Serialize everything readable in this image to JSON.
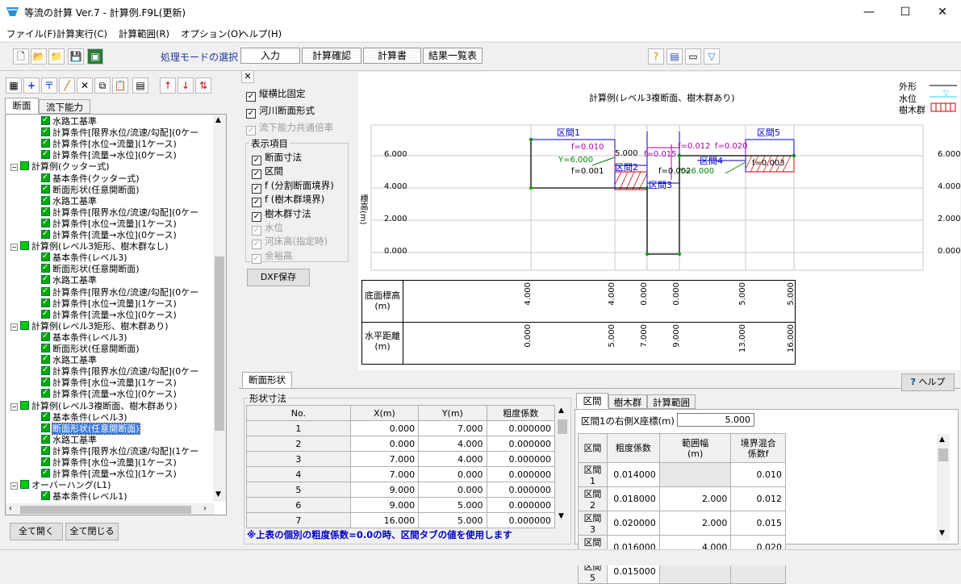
{
  "window": {
    "title": "等流の計算 Ver.7 - 計算例.F9L(更新)",
    "min": "—",
    "max": "☐",
    "close": "✕"
  },
  "menu": [
    "ファイル(F)",
    "計算実行(C)",
    "計算範囲(R)",
    "オプション(O)",
    "ヘルプ(H)"
  ],
  "mode": {
    "label": "処理モードの選択",
    "buttons": [
      "入力",
      "計算確認",
      "計算書",
      "結果一覧表"
    ]
  },
  "left": {
    "tabs": [
      "断面",
      "流下能力"
    ],
    "tree": [
      {
        "indent": 2,
        "expander": "",
        "text": "水路工基準"
      },
      {
        "indent": 2,
        "expander": "",
        "text": "計算条件[限界水位/流速/勾配](0ケー"
      },
      {
        "indent": 2,
        "expander": "",
        "text": "計算条件[水位→流量](1ケース)"
      },
      {
        "indent": 2,
        "expander": "",
        "text": "計算条件[流量→水位](0ケース)"
      },
      {
        "indent": 1,
        "expander": "−",
        "text": "計算例(クッター式)"
      },
      {
        "indent": 2,
        "expander": "",
        "text": "基本条件(クッター式)"
      },
      {
        "indent": 2,
        "expander": "",
        "text": "断面形状(任意開断面)"
      },
      {
        "indent": 2,
        "expander": "",
        "text": "水路工基準"
      },
      {
        "indent": 2,
        "expander": "",
        "text": "計算条件[限界水位/流速/勾配](0ケー"
      },
      {
        "indent": 2,
        "expander": "",
        "text": "計算条件[水位→流量](1ケース)"
      },
      {
        "indent": 2,
        "expander": "",
        "text": "計算条件[流量→水位](0ケース)"
      },
      {
        "indent": 1,
        "expander": "−",
        "text": "計算例(レベル3矩形、樹木群なし)"
      },
      {
        "indent": 2,
        "expander": "",
        "text": "基本条件(レベル3)"
      },
      {
        "indent": 2,
        "expander": "",
        "text": "断面形状(任意開断面)"
      },
      {
        "indent": 2,
        "expander": "",
        "text": "水路工基準"
      },
      {
        "indent": 2,
        "expander": "",
        "text": "計算条件[限界水位/流速/勾配](0ケー"
      },
      {
        "indent": 2,
        "expander": "",
        "text": "計算条件[水位→流量](1ケース)"
      },
      {
        "indent": 2,
        "expander": "",
        "text": "計算条件[流量→水位](0ケース)"
      },
      {
        "indent": 1,
        "expander": "−",
        "text": "計算例(レベル3矩形、樹木群あり)"
      },
      {
        "indent": 2,
        "expander": "",
        "text": "基本条件(レベル3)"
      },
      {
        "indent": 2,
        "expander": "",
        "text": "断面形状(任意開断面)"
      },
      {
        "indent": 2,
        "expander": "",
        "text": "水路工基準"
      },
      {
        "indent": 2,
        "expander": "",
        "text": "計算条件[限界水位/流速/勾配](0ケー"
      },
      {
        "indent": 2,
        "expander": "",
        "text": "計算条件[水位→流量](1ケース)"
      },
      {
        "indent": 2,
        "expander": "",
        "text": "計算条件[流量→水位](0ケース)"
      },
      {
        "indent": 1,
        "expander": "−",
        "text": "計算例(レベル3複断面、樹木群あり)"
      },
      {
        "indent": 2,
        "expander": "",
        "text": "基本条件(レベル3)"
      },
      {
        "indent": 2,
        "expander": "",
        "text": "断面形状(任意開断面)",
        "selected": true
      },
      {
        "indent": 2,
        "expander": "",
        "text": "水路工基準"
      },
      {
        "indent": 2,
        "expander": "",
        "text": "計算条件[限界水位/流速/勾配](1ケー"
      },
      {
        "indent": 2,
        "expander": "",
        "text": "計算条件[水位→流量](1ケース)"
      },
      {
        "indent": 2,
        "expander": "",
        "text": "計算条件[流量→水位](1ケース)"
      },
      {
        "indent": 1,
        "expander": "−",
        "text": "オーバーハング(L1)"
      },
      {
        "indent": 2,
        "expander": "",
        "text": "基本条件(レベル1)"
      }
    ],
    "expand_all": "全て開く",
    "collapse_all": "全て閉じる"
  },
  "options": {
    "close": "✕",
    "aspect": "縦横比固定",
    "river": "河川断面形式",
    "common": "流下能力共通倍率",
    "group": "表示項目",
    "items": [
      {
        "label": "断面寸法",
        "on": true,
        "enabled": true
      },
      {
        "label": "区間",
        "on": true,
        "enabled": true
      },
      {
        "label": "f (分割断面境界)",
        "on": true,
        "enabled": true
      },
      {
        "label": "f (樹木群境界)",
        "on": true,
        "enabled": true
      },
      {
        "label": "樹木群寸法",
        "on": true,
        "enabled": true
      },
      {
        "label": "水位",
        "on": true,
        "enabled": false
      },
      {
        "label": "河床高(指定時)",
        "on": true,
        "enabled": false
      },
      {
        "label": "余裕高",
        "on": true,
        "enabled": false
      }
    ],
    "dxf": "DXF保存"
  },
  "chart": {
    "title": "計算例(レベル3複断面、樹木群あり)",
    "ylabel": "標高(m)",
    "yticks": [
      "6.000",
      "4.000",
      "2.000",
      "0.000"
    ],
    "legend": {
      "outline": "外形",
      "water": "水位",
      "trees": "樹木群"
    },
    "labels": {
      "k1": "区間1",
      "k2": "区間2",
      "k3": "区間3",
      "k4": "区間4",
      "k5": "区間5",
      "f1": "f=0.010",
      "f2": "f=0.015",
      "f3": "f=0.012",
      "f4": "f=0.020",
      "f5": "f=0.001",
      "f6": "f=0.002",
      "f7": "f=0.003",
      "w1": "5.000",
      "y1": "Y=6.000",
      "y2": "Y=6.000"
    },
    "bed_label": "底面標高\n(m)",
    "dist_label": "水平距離\n(m)",
    "bed_values": [
      "4.000",
      "4.000",
      "0.000",
      "0.000",
      "5.000",
      "5.000"
    ],
    "dist_values": [
      "0.000",
      "5.000",
      "7.000",
      "9.000",
      "13.000",
      "16.000"
    ]
  },
  "bottom": {
    "tab": "断面形状",
    "help": "ヘルプ",
    "group": "形状寸法",
    "shape_headers": [
      "No.",
      "X(m)",
      "Y(m)",
      "粗度係数"
    ],
    "shape_rows": [
      [
        "1",
        "0.000",
        "7.000",
        "0.000000"
      ],
      [
        "2",
        "0.000",
        "4.000",
        "0.000000"
      ],
      [
        "3",
        "7.000",
        "4.000",
        "0.000000"
      ],
      [
        "4",
        "7.000",
        "0.000",
        "0.000000"
      ],
      [
        "5",
        "9.000",
        "0.000",
        "0.000000"
      ],
      [
        "6",
        "9.000",
        "5.000",
        "0.000000"
      ],
      [
        "7",
        "16.000",
        "5.000",
        "0.000000"
      ]
    ],
    "note": "※上表の個別の粗度係数=0.0の時、区間タブの値を使用します",
    "rtabs": [
      "区間",
      "樹木群",
      "計算範囲"
    ],
    "rlabel": "区間1の右側X座標(m)",
    "rvalue": "5.000",
    "sec_headers": [
      "区間",
      "粗度係数",
      "範囲幅\n(m)",
      "境界混合\n係数f"
    ],
    "sec_rows": [
      [
        "区間1",
        "0.014000",
        "",
        "0.010"
      ],
      [
        "区間2",
        "0.018000",
        "2.000",
        "0.012"
      ],
      [
        "区間3",
        "0.020000",
        "2.000",
        "0.015"
      ],
      [
        "区間4",
        "0.016000",
        "4.000",
        "0.020"
      ],
      [
        "区間5",
        "0.015000",
        "",
        ""
      ]
    ]
  }
}
